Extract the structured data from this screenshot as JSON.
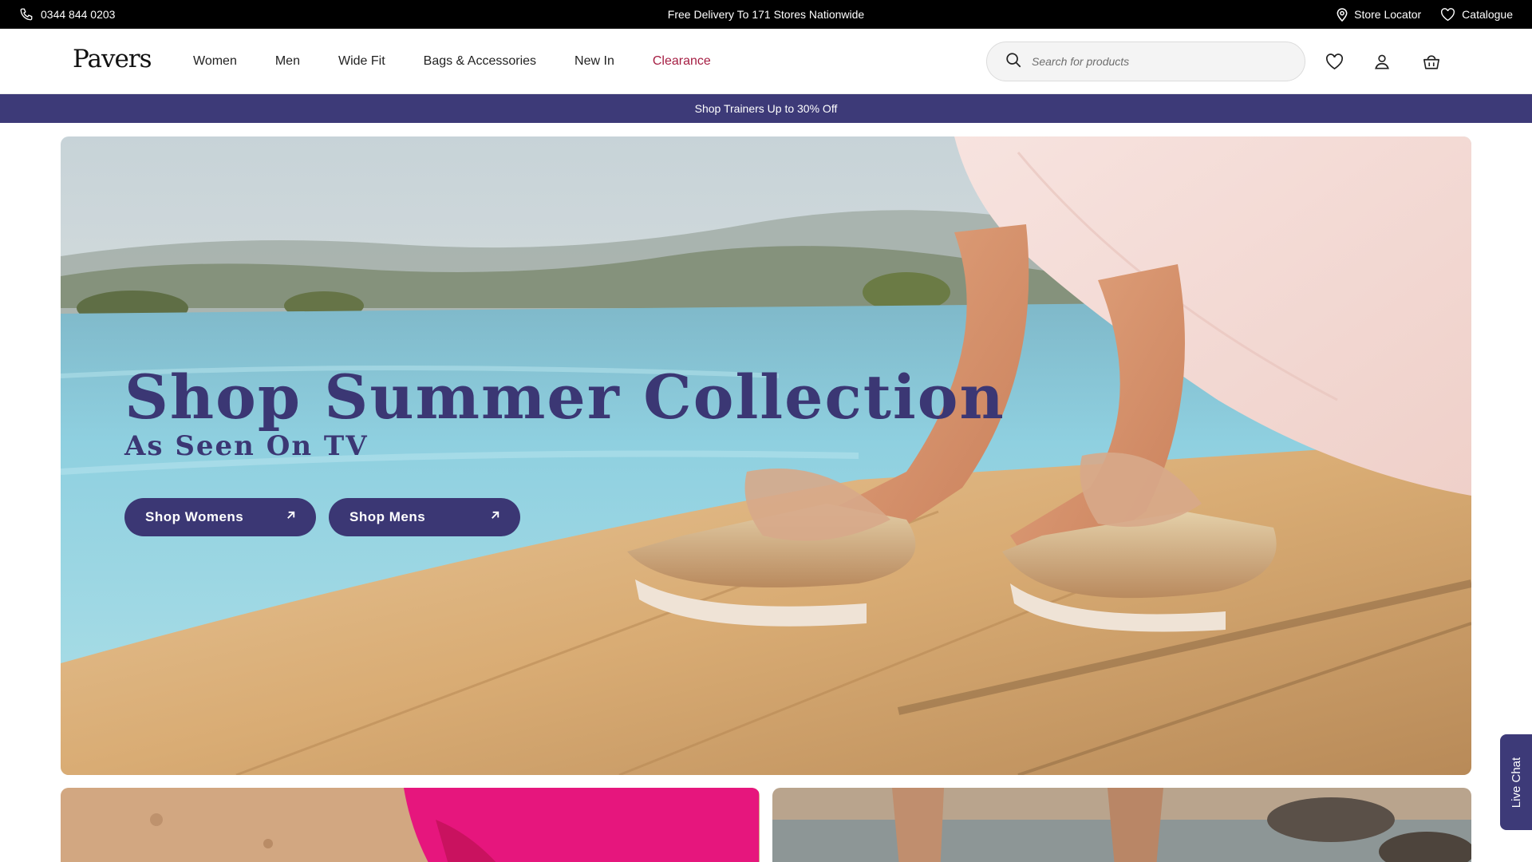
{
  "topbar": {
    "phone": "0344 844 0203",
    "promo": "Free Delivery To 171 Stores Nationwide",
    "store_locator": "Store Locator",
    "catalogue": "Catalogue"
  },
  "header": {
    "logo": "Pavers",
    "nav": [
      "Women",
      "Men",
      "Wide Fit",
      "Bags & Accessories",
      "New In",
      "Clearance"
    ],
    "search_placeholder": "Search for products"
  },
  "strip": {
    "text": "Shop Trainers Up to 30% Off"
  },
  "hero": {
    "title": "Shop Summer Collection",
    "subtitle": "As Seen On TV",
    "cta_women": "Shop Womens",
    "cta_men": "Shop Mens"
  },
  "live_chat": "Live Chat",
  "colors": {
    "brand_purple": "#3b3774",
    "clearance_red": "#a51d42",
    "topbar_black": "#000000"
  },
  "icons": [
    "phone-icon",
    "location-pin-icon",
    "heart-icon",
    "search-icon",
    "wishlist-icon",
    "account-icon",
    "basket-icon",
    "arrow-up-right-icon"
  ]
}
